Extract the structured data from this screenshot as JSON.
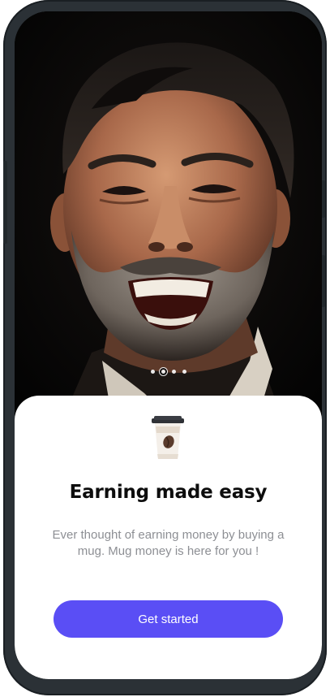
{
  "onboarding": {
    "pager": {
      "count": 4,
      "active_index": 1
    },
    "icon": "coffee-cup-icon",
    "title": "Earning made easy",
    "subtitle": "Ever thought of earning money by buying a mug. Mug money is here for you !",
    "cta_label": "Get started"
  },
  "colors": {
    "accent": "#5a4ef5",
    "title": "#0d0d0d",
    "subtitle": "#8d8f94",
    "frame": "#2b3136"
  }
}
